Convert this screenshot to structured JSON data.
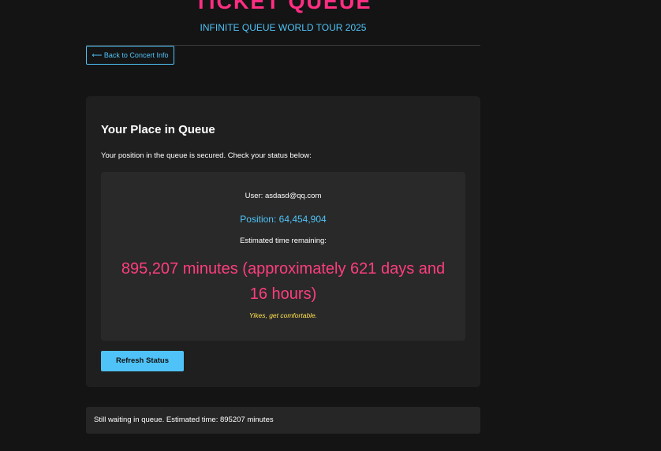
{
  "header": {
    "title": "TICKET QUEUE",
    "subtitle": "INFINITE QUEUE WORLD TOUR 2025"
  },
  "nav": {
    "back_label": "⟵ Back to Concert Info"
  },
  "queue_card": {
    "title": "Your Place in Queue",
    "intro": "Your position in the queue is secured. Check your status below:",
    "status": {
      "user": "User: asdasd@qq.com",
      "position": "Position: 64,454,904",
      "estimate_label": "Estimated time remaining:",
      "estimate_value": "895,207 minutes (approximately 621 days and 16 hours)",
      "quip": "Yikes, get comfortable."
    },
    "refresh_label": "Refresh Status"
  },
  "status_bar": {
    "message": "Still waiting in queue. Estimated time: 895207 minutes"
  },
  "colors": {
    "accent_pink": "#ff2e82",
    "accent_blue": "#4fc3f7",
    "warning_yellow": "#ffe14d",
    "background": "#141414",
    "card": "#1f1f1f"
  }
}
